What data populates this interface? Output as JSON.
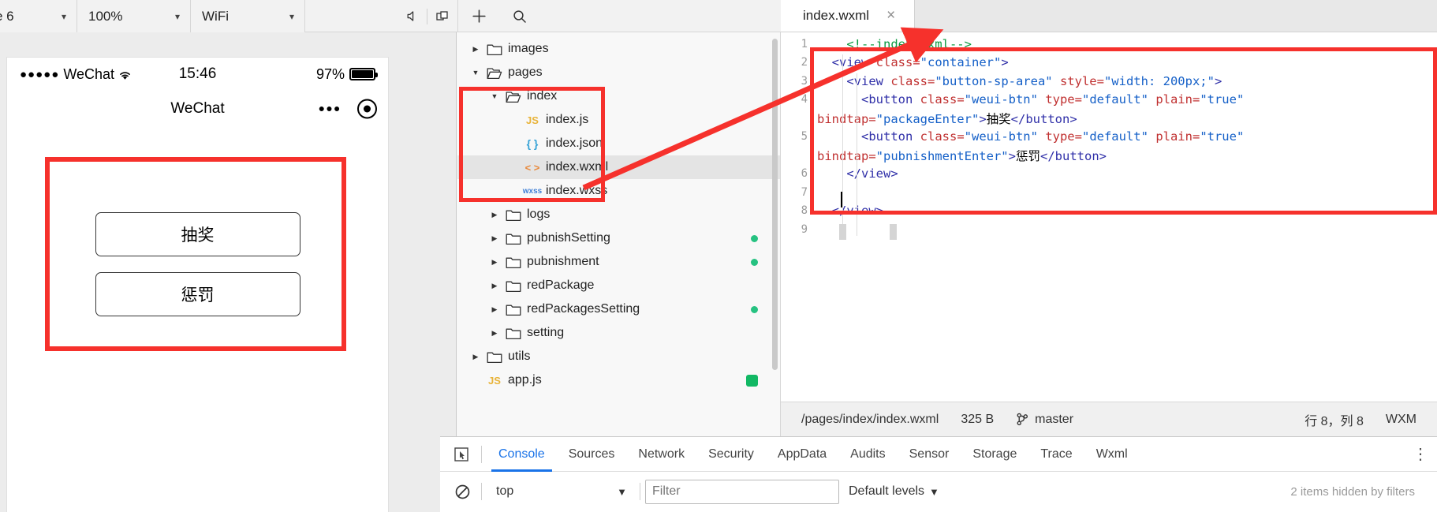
{
  "toolbar": {
    "device": "e 6",
    "zoom": "100%",
    "network": "WiFi",
    "icons": {
      "mute": "mute-icon",
      "windows": "windows-icon",
      "add": "plus-icon",
      "search": "search-icon",
      "more": "more-icon",
      "details": "details-icon",
      "panel": "panel-toggle-icon"
    }
  },
  "simulator": {
    "status_bar": {
      "signal": "●●●●●",
      "carrier": "WeChat",
      "wifi": "wifi-icon",
      "time": "15:46",
      "battery_percent": "97%"
    },
    "nav": {
      "title": "WeChat",
      "capsule_more": "•••",
      "capsule_target": "target-icon"
    },
    "buttons": [
      {
        "label": "抽奖"
      },
      {
        "label": "惩罚"
      }
    ]
  },
  "file_tree": {
    "items": [
      {
        "indent": 0,
        "twisty": "collapsed",
        "icon": "folder-closed",
        "name": "images",
        "dot": false
      },
      {
        "indent": 0,
        "twisty": "expanded",
        "icon": "folder-open",
        "name": "pages",
        "dot": false
      },
      {
        "indent": 1,
        "twisty": "expanded",
        "icon": "folder-open",
        "name": "index",
        "dot": false
      },
      {
        "indent": 2,
        "twisty": "none",
        "icon": "js",
        "name": "index.js",
        "dot": false
      },
      {
        "indent": 2,
        "twisty": "none",
        "icon": "json",
        "name": "index.json",
        "dot": false
      },
      {
        "indent": 2,
        "twisty": "none",
        "icon": "wxml",
        "name": "index.wxml",
        "dot": false,
        "selected": true
      },
      {
        "indent": 2,
        "twisty": "none",
        "icon": "wxss",
        "name": "index.wxss",
        "dot": false
      },
      {
        "indent": 1,
        "twisty": "collapsed",
        "icon": "folder-closed",
        "name": "logs",
        "dot": false
      },
      {
        "indent": 1,
        "twisty": "collapsed",
        "icon": "folder-closed",
        "name": "pubnishSetting",
        "dot": true
      },
      {
        "indent": 1,
        "twisty": "collapsed",
        "icon": "folder-closed",
        "name": "pubnishment",
        "dot": true
      },
      {
        "indent": 1,
        "twisty": "collapsed",
        "icon": "folder-closed",
        "name": "redPackage",
        "dot": false
      },
      {
        "indent": 1,
        "twisty": "collapsed",
        "icon": "folder-closed",
        "name": "redPackagesSetting",
        "dot": true
      },
      {
        "indent": 1,
        "twisty": "collapsed",
        "icon": "folder-closed",
        "name": "setting",
        "dot": false
      },
      {
        "indent": 0,
        "twisty": "collapsed",
        "icon": "folder-closed",
        "name": "utils",
        "dot": false
      },
      {
        "indent": 0,
        "twisty": "none",
        "icon": "js",
        "name": "app.js",
        "dot": false,
        "dot_icon": true
      }
    ]
  },
  "editor": {
    "tab": {
      "title": "index.wxml",
      "close": "×"
    },
    "lines": [
      {
        "no": "1",
        "segments": [
          {
            "t": "    ",
            "c": "k-plain"
          },
          {
            "t": "<!--index.wxml-->",
            "c": "k-comment"
          }
        ]
      },
      {
        "no": "2",
        "segments": [
          {
            "t": "  ",
            "c": "k-plain"
          },
          {
            "t": "<view ",
            "c": "k-tag"
          },
          {
            "t": "class=",
            "c": "k-attr"
          },
          {
            "t": "\"container\"",
            "c": "k-val"
          },
          {
            "t": ">",
            "c": "k-tag"
          }
        ]
      },
      {
        "no": "3",
        "segments": [
          {
            "t": "    ",
            "c": "k-plain"
          },
          {
            "t": "<view ",
            "c": "k-tag"
          },
          {
            "t": "class=",
            "c": "k-attr"
          },
          {
            "t": "\"button-sp-area\" ",
            "c": "k-val"
          },
          {
            "t": "style=",
            "c": "k-attr"
          },
          {
            "t": "\"width: 200px;\"",
            "c": "k-val"
          },
          {
            "t": ">",
            "c": "k-tag"
          }
        ]
      },
      {
        "no": "4",
        "segments": [
          {
            "t": "      ",
            "c": "k-plain"
          },
          {
            "t": "<button ",
            "c": "k-tag"
          },
          {
            "t": "class=",
            "c": "k-attr"
          },
          {
            "t": "\"weui-btn\" ",
            "c": "k-val"
          },
          {
            "t": "type=",
            "c": "k-attr"
          },
          {
            "t": "\"default\" ",
            "c": "k-val"
          },
          {
            "t": "plain=",
            "c": "k-attr"
          },
          {
            "t": "\"true\"",
            "c": "k-val"
          }
        ]
      },
      {
        "no": "",
        "segments": [
          {
            "t": "",
            "c": "k-plain"
          },
          {
            "t": "bindtap=",
            "c": "k-attr"
          },
          {
            "t": "\"packageEnter\"",
            "c": "k-val"
          },
          {
            "t": ">",
            "c": "k-tag"
          },
          {
            "t": "抽奖",
            "c": "k-txt"
          },
          {
            "t": "</button>",
            "c": "k-tag"
          }
        ]
      },
      {
        "no": "5",
        "segments": [
          {
            "t": "      ",
            "c": "k-plain"
          },
          {
            "t": "<button ",
            "c": "k-tag"
          },
          {
            "t": "class=",
            "c": "k-attr"
          },
          {
            "t": "\"weui-btn\" ",
            "c": "k-val"
          },
          {
            "t": "type=",
            "c": "k-attr"
          },
          {
            "t": "\"default\" ",
            "c": "k-val"
          },
          {
            "t": "plain=",
            "c": "k-attr"
          },
          {
            "t": "\"true\"",
            "c": "k-val"
          }
        ]
      },
      {
        "no": "",
        "segments": [
          {
            "t": "",
            "c": "k-plain"
          },
          {
            "t": "bindtap=",
            "c": "k-attr"
          },
          {
            "t": "\"pubnishmentEnter\"",
            "c": "k-val"
          },
          {
            "t": ">",
            "c": "k-tag"
          },
          {
            "t": "惩罚",
            "c": "k-txt"
          },
          {
            "t": "</button>",
            "c": "k-tag"
          }
        ]
      },
      {
        "no": "6",
        "segments": [
          {
            "t": "    ",
            "c": "k-plain"
          },
          {
            "t": "</view>",
            "c": "k-tag"
          }
        ]
      },
      {
        "no": "7",
        "segments": [
          {
            "t": "",
            "c": "k-plain"
          }
        ]
      },
      {
        "no": "8",
        "segments": [
          {
            "t": "  ",
            "c": "k-plain"
          },
          {
            "t": "</view>",
            "c": "k-tag"
          }
        ]
      },
      {
        "no": "9",
        "segments": [
          {
            "t": "",
            "c": "k-plain"
          }
        ]
      }
    ],
    "status": {
      "path": "/pages/index/index.wxml",
      "size": "325 B",
      "branch": "master",
      "cursor": "行 8，列 8",
      "language": "WXM"
    }
  },
  "devtools": {
    "inspect_icon": "inspect-element-icon",
    "tabs": [
      {
        "label": "Console",
        "active": true
      },
      {
        "label": "Sources",
        "active": false
      },
      {
        "label": "Network",
        "active": false
      },
      {
        "label": "Security",
        "active": false
      },
      {
        "label": "AppData",
        "active": false
      },
      {
        "label": "Audits",
        "active": false
      },
      {
        "label": "Sensor",
        "active": false
      },
      {
        "label": "Storage",
        "active": false
      },
      {
        "label": "Trace",
        "active": false
      },
      {
        "label": "Wxml",
        "active": false
      }
    ],
    "kebab": "⋮",
    "filter_bar": {
      "clear_icon": "clear-console-icon",
      "context": "top",
      "filter_placeholder": "Filter",
      "filter_value": "",
      "levels": "Default levels",
      "hidden_message": "2 items hidden by filters"
    }
  },
  "colors": {
    "accent_red": "#f6312c",
    "tab_blue": "#1a73e8",
    "green_dot": "#26c281"
  }
}
